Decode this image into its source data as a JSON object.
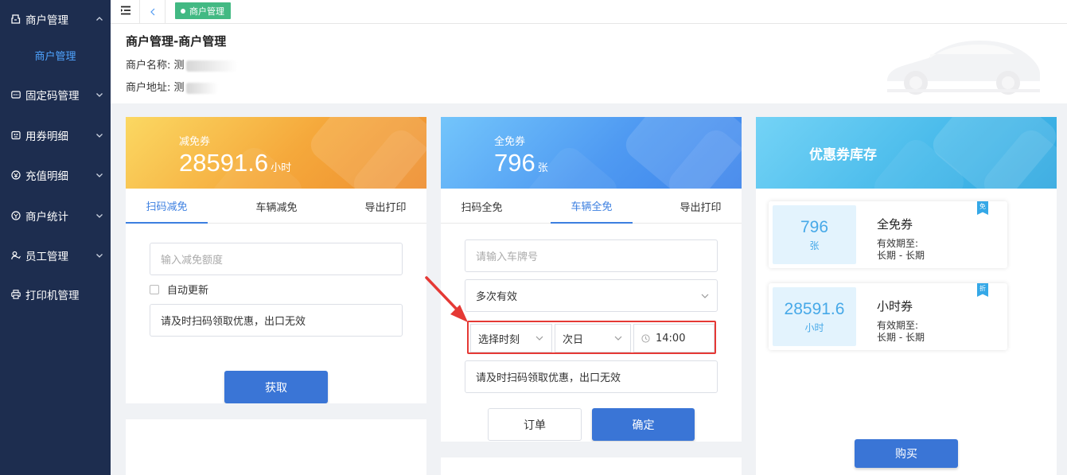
{
  "sidebar": {
    "items": [
      {
        "label": "商户管理",
        "icon": "store-icon"
      },
      {
        "label": "固定码管理",
        "icon": "qrcode-icon"
      },
      {
        "label": "用券明细",
        "icon": "coupon-icon"
      },
      {
        "label": "充值明细",
        "icon": "recharge-icon"
      },
      {
        "label": "商户统计",
        "icon": "stats-icon"
      },
      {
        "label": "员工管理",
        "icon": "staff-icon"
      },
      {
        "label": "打印机管理",
        "icon": "printer-icon"
      }
    ],
    "active_sub": "商户管理",
    "active_color": "#4fa4ff",
    "bg_color": "#1d2d4f"
  },
  "topbar": {
    "tag_label": "商户管理",
    "tag_color": "#42b983"
  },
  "header": {
    "title": "商户管理-商户管理",
    "name_label": "商户名称: 测",
    "address_label": "商户地址: 测"
  },
  "card_reduce": {
    "label": "减免券",
    "value": "28591.6",
    "unit": "小时",
    "tabs": [
      "扫码减免",
      "车辆减免",
      "导出打印"
    ],
    "active_tab": 0,
    "amount_placeholder": "输入减免额度",
    "auto_update_label": "自动更新",
    "notice": "请及时扫码领取优惠，出口无效",
    "get_button": "获取"
  },
  "card_free": {
    "label": "全免券",
    "value": "796",
    "unit": "张",
    "tabs": [
      "扫码全免",
      "车辆全免",
      "导出打印"
    ],
    "active_tab": 1,
    "plate_placeholder": "请输入车牌号",
    "validity_select": "多次有效",
    "time_select": "选择时刻",
    "day_select": "次日",
    "time_value": "14:00",
    "notice": "请及时扫码领取优惠，出口无效",
    "order_button": "订单",
    "confirm_button": "确定"
  },
  "card_stock": {
    "title": "优惠券库存",
    "items": [
      {
        "num": "796",
        "unit": "张",
        "name": "全免券",
        "valid_label": "有效期至:",
        "valid_range": "长期 - 长期",
        "flag": "免"
      },
      {
        "num": "28591.6",
        "unit": "小时",
        "name": "小时券",
        "valid_label": "有效期至:",
        "valid_range": "长期 - 长期",
        "flag": "折"
      }
    ],
    "buy_button": "购买"
  },
  "colors": {
    "primary": "#3a75d6",
    "annotation_red": "#e53935"
  }
}
